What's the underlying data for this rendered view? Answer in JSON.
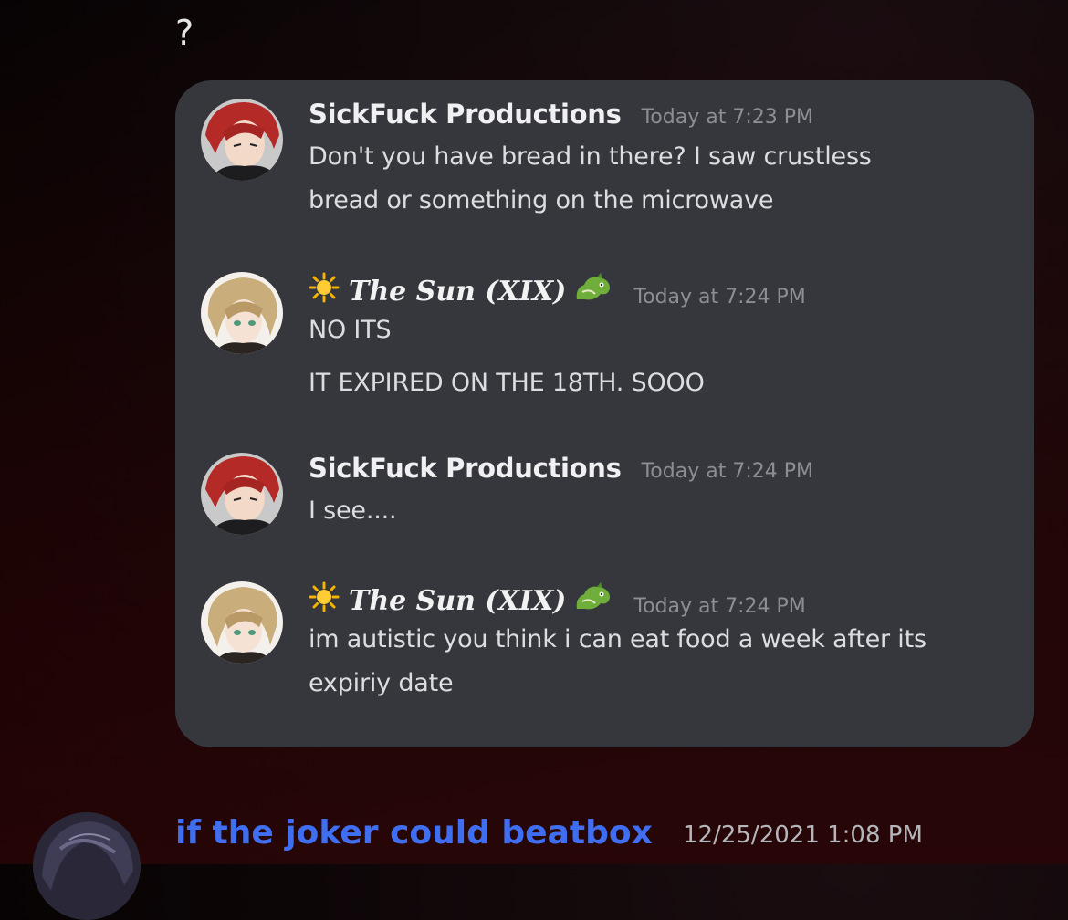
{
  "top_text": "?",
  "quote": {
    "messages": [
      {
        "author": "SickFuck Productions",
        "timestamp": "Today at 7:23 PM",
        "avatar": "red-hair-avatar",
        "lines": [
          "Don't you have bread in there? I saw crustless",
          "bread or something on the microwave"
        ]
      },
      {
        "author": "The Sun (XIX)",
        "author_prefix_icon": "sun-emoji-icon",
        "author_suffix_icon": "dragon-emoji-icon",
        "timestamp": "Today at 7:24 PM",
        "avatar": "blonde-anime-avatar",
        "lines": [
          "NO ITS",
          "IT EXPIRED ON THE 18TH. SOOO"
        ]
      },
      {
        "author": "SickFuck Productions",
        "timestamp": "Today at 7:24 PM",
        "avatar": "red-hair-avatar",
        "lines": [
          "I see...."
        ]
      },
      {
        "author": "The Sun (XIX)",
        "author_prefix_icon": "sun-emoji-icon",
        "author_suffix_icon": "dragon-emoji-icon",
        "timestamp": "Today at 7:24 PM",
        "avatar": "blonde-anime-avatar",
        "lines": [
          "im autistic  you think i can eat food a week after its",
          "expiriy date"
        ]
      }
    ]
  },
  "bottom_message": {
    "author": "if the joker could beatbox",
    "timestamp": "12/25/2021 1:08 PM",
    "author_color": "#3f6ff0"
  },
  "colors": {
    "card_bg": "#36373d",
    "timestamp": "#8c8e94",
    "text": "#dcdde0"
  }
}
